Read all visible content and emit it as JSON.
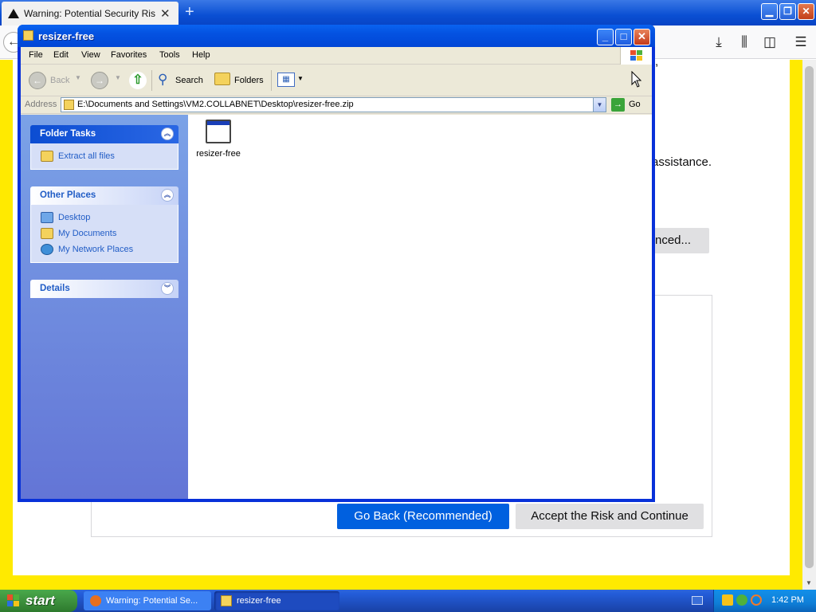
{
  "firefox": {
    "tab_title": "Warning: Potential Security Risk Ahead",
    "new_tab": "+",
    "fragment_comma": ",",
    "fragment_assistance": "assistance.",
    "advanced_label": "nced...",
    "go_back_label": "Go Back (Recommended)",
    "accept_label": "Accept the Risk and Continue"
  },
  "explorer": {
    "title": "resizer-free",
    "menu": [
      "File",
      "Edit",
      "View",
      "Favorites",
      "Tools",
      "Help"
    ],
    "toolbar": {
      "back": "Back",
      "search": "Search",
      "folders": "Folders"
    },
    "address_label": "Address",
    "address_value": "E:\\Documents and Settings\\VM2.COLLABNET\\Desktop\\resizer-free.zip",
    "go_label": "Go",
    "folder_tasks": {
      "title": "Folder Tasks",
      "items": [
        "Extract all files"
      ]
    },
    "other_places": {
      "title": "Other Places",
      "items": [
        "Desktop",
        "My Documents",
        "My Network Places"
      ]
    },
    "details": {
      "title": "Details"
    },
    "files": [
      {
        "name": "resizer-free"
      }
    ]
  },
  "taskbar": {
    "start_label": "start",
    "tasks": [
      {
        "label": "Warning: Potential Se..."
      },
      {
        "label": "resizer-free"
      }
    ],
    "clock": "1:42 PM"
  },
  "colors": {
    "warning_border": "#ffea00",
    "primary_button": "#0060df",
    "xp_titlebar": "#0146d6",
    "taskpane_link": "#215dc6"
  }
}
